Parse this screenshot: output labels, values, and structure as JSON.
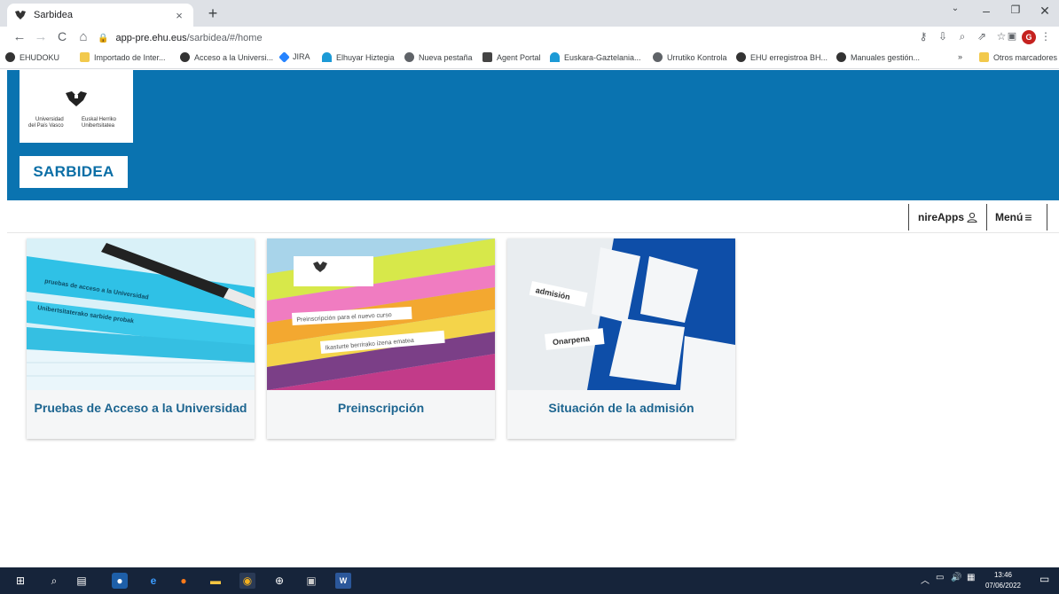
{
  "browser": {
    "tab_title": "Sarbidea",
    "tab_close": "×",
    "new_tab": "+",
    "url_host": "app-pre.ehu.eus",
    "url_path": "/sarbidea/#/home",
    "avatar_letter": "G"
  },
  "bookmarks": [
    {
      "label": "EHUDOKU"
    },
    {
      "label": "Importado de Inter..."
    },
    {
      "label": "Acceso a la Universi..."
    },
    {
      "label": "JIRA"
    },
    {
      "label": "Elhuyar Hiztegia"
    },
    {
      "label": "Nueva pestaña"
    },
    {
      "label": "Agent Portal"
    },
    {
      "label": "Euskara-Gaztelania..."
    },
    {
      "label": "Urrutiko Kontrola"
    },
    {
      "label": "EHU erregistroa BH..."
    },
    {
      "label": "Manuales gestión..."
    },
    {
      "label": "»"
    },
    {
      "label": "Otros marcadores"
    }
  ],
  "header": {
    "logo_line1": "Universidad",
    "logo_line2": "del País Vasco",
    "logo_line3": "Euskal Herriko",
    "logo_line4": "Unibertsitatea",
    "app_name": "SARBIDEA"
  },
  "nav": {
    "nireapps": "nireApps",
    "menu": "Menú"
  },
  "cards": [
    {
      "title": "Pruebas de Acceso a la Universidad",
      "img_text1": "pruebas de acceso a la Universidad",
      "img_text2": "Unibertsitaterako sarbide probak"
    },
    {
      "title": "Preinscripción",
      "img_text1": "Preinscripción para el nuevo curso",
      "img_text2": "Ikasturte berrirako izena ematea"
    },
    {
      "title": "Situación de la admisión",
      "img_text1": "admisión",
      "img_text2": "Onarpena"
    }
  ],
  "taskbar": {
    "time": "13:46",
    "date": "07/06/2022"
  },
  "colors": {
    "brand_blue": "#0a73b0",
    "card_title": "#1d6590"
  }
}
